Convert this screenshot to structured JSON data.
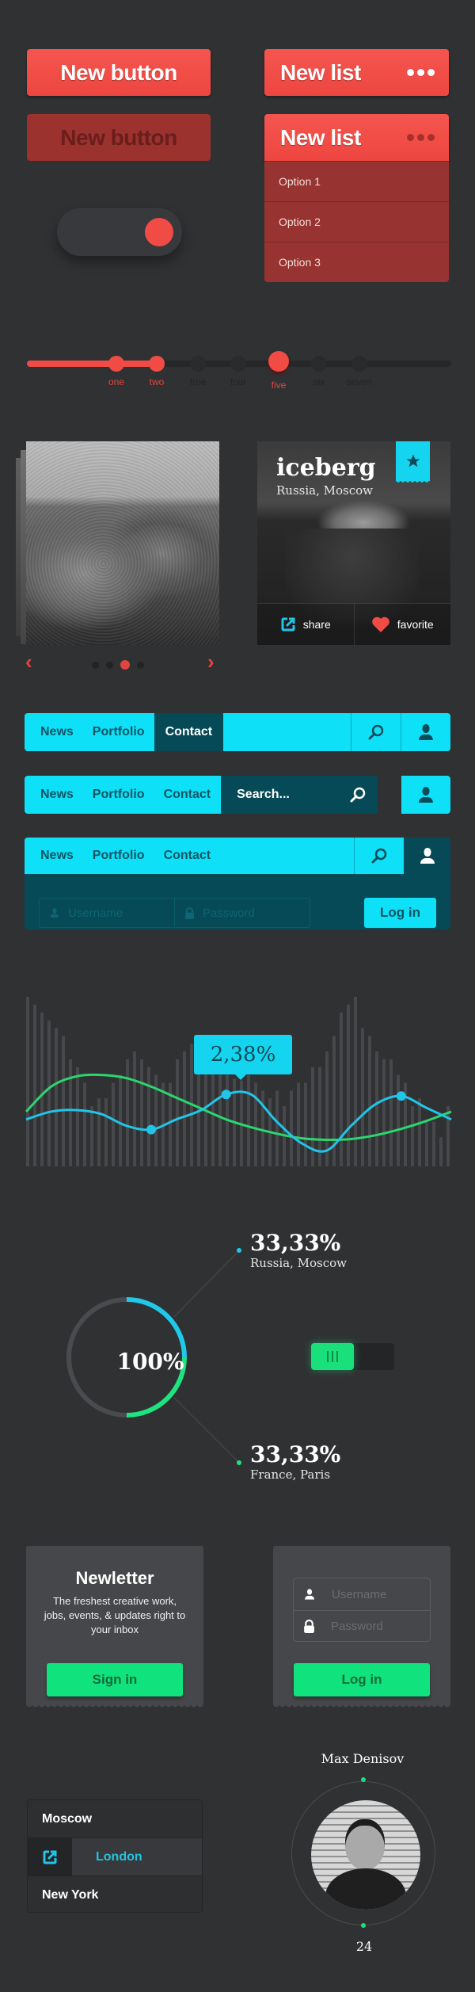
{
  "colors": {
    "background": "#303133",
    "red": "#f04c45",
    "cyan": "#0ee0f7",
    "teal_dark": "#054a56",
    "green": "#10e37d"
  },
  "buttons": {
    "new_button": "New button",
    "new_button_disabled": "New button"
  },
  "toggle": {
    "state": "on"
  },
  "lists": {
    "closed": {
      "title": "New list",
      "menu_icon": "more-dots-icon"
    },
    "open": {
      "title": "New list",
      "menu_icon": "more-dots-icon",
      "options": [
        "Option 1",
        "Option 2",
        "Option 3"
      ]
    }
  },
  "step_slider": {
    "steps": [
      "one",
      "two",
      "free",
      "four",
      "five",
      "six",
      "seven"
    ],
    "filled_through": "two",
    "highlighted": "five"
  },
  "gallery": {
    "pages": 4,
    "current_page": 3,
    "prev_icon": "chevron-left-icon",
    "next_icon": "chevron-right-icon"
  },
  "iceberg_card": {
    "title": "iceberg",
    "subtitle": "Russia, Moscow",
    "share": "share",
    "favorite": "favorite"
  },
  "nav1": {
    "items": [
      "News",
      "Portfolio",
      "Contact"
    ],
    "active": "Contact"
  },
  "nav2": {
    "items": [
      "News",
      "Portfolio",
      "Contact"
    ],
    "search_value": "Search..."
  },
  "nav3": {
    "items": [
      "News",
      "Portfolio",
      "Contact"
    ],
    "username_placeholder": "Username",
    "password_placeholder": "Password",
    "login": "Log in"
  },
  "chart_data": {
    "type": "bar",
    "title": "",
    "xlabel": "",
    "ylabel": "",
    "tooltip": "2,38%",
    "bar_values": [
      217,
      207,
      197,
      187,
      177,
      167,
      137,
      127,
      107,
      77,
      87,
      87,
      107,
      117,
      137,
      147,
      137,
      127,
      117,
      107,
      107,
      137,
      147,
      157,
      147,
      137,
      127,
      117,
      117,
      112,
      110,
      117,
      107,
      97,
      87,
      97,
      77,
      97,
      107,
      107,
      127,
      127,
      147,
      167,
      197,
      207,
      217,
      177,
      167,
      147,
      137,
      137,
      117,
      107,
      77,
      87,
      57,
      57,
      37,
      77
    ],
    "ylim": [
      0,
      220
    ],
    "series": [
      {
        "name": "green",
        "color": "#2bd66f",
        "values": [
          70,
          102,
          115,
          117,
          113,
          102,
          88,
          74,
          60,
          50,
          42,
          36,
          34,
          35,
          40,
          48,
          58,
          70
        ]
      },
      {
        "name": "blue",
        "color": "#22c4e8",
        "values": [
          60,
          70,
          72,
          67,
          52,
          47,
          60,
          72,
          92,
          92,
          58,
          30,
          20,
          52,
          80,
          90,
          75,
          60
        ]
      }
    ],
    "highlight_points_series": "blue",
    "highlight_points_index": [
      5,
      8,
      15
    ]
  },
  "donut": {
    "center": "100%",
    "segments": [
      {
        "label": "Russia, Moscow",
        "value": "33,33%",
        "color": "#1fc9ea"
      },
      {
        "label": "France, Paris",
        "value": "33,33%",
        "color": "#1ee37f"
      },
      {
        "label": "",
        "value": "33,33%",
        "color": "#4a4b4e"
      }
    ]
  },
  "switch2": {
    "state": "on"
  },
  "newsletter": {
    "title": "Newletter",
    "text": "The freshest creative work, jobs, events, & updates right to your inbox",
    "button": "Sign in"
  },
  "login_card": {
    "username_placeholder": "Username",
    "password_placeholder": "Password",
    "button": "Log in"
  },
  "cities": {
    "items": [
      "Moscow",
      "London",
      "New York"
    ],
    "selected": "London"
  },
  "profile": {
    "name": "Max Denisov",
    "number": "24"
  }
}
